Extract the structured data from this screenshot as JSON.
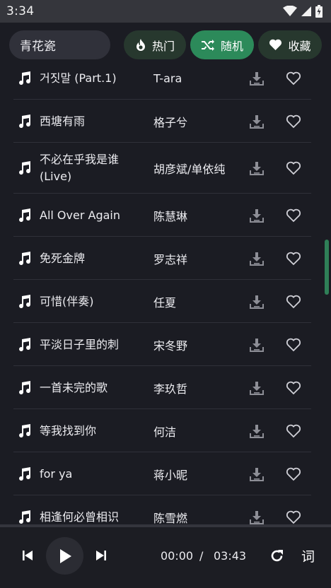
{
  "status": {
    "time": "3:34"
  },
  "search": {
    "value": "青花瓷"
  },
  "tabs": [
    {
      "label": "热门",
      "icon": "fire-icon"
    },
    {
      "label": "随机",
      "icon": "shuffle-icon"
    },
    {
      "label": "收藏",
      "icon": "heart-icon"
    }
  ],
  "songs": [
    {
      "title": "거짓말 (Part.1)",
      "artist": "T-ara"
    },
    {
      "title": "西塘有雨",
      "artist": "格子兮"
    },
    {
      "title": "不必在乎我是谁(Live)",
      "artist": "胡彦斌/单依纯"
    },
    {
      "title": "All Over Again",
      "artist": "陈慧琳"
    },
    {
      "title": "免死金牌",
      "artist": "罗志祥"
    },
    {
      "title": "可惜(伴奏)",
      "artist": "任夏"
    },
    {
      "title": "平淡日子里的刺",
      "artist": "宋冬野"
    },
    {
      "title": "一首未完的歌",
      "artist": "李玖哲"
    },
    {
      "title": "等我找到你",
      "artist": "何洁"
    },
    {
      "title": "for ya",
      "artist": "蒋小昵"
    },
    {
      "title": "相逢何必曾相识",
      "artist": "陈雪燃"
    }
  ],
  "player": {
    "current_time": "00:00",
    "separator": "/",
    "total_time": "03:43",
    "progress": 0,
    "lyrics_label": "词"
  },
  "colors": {
    "accent": "#2c8a5a",
    "background": "#1b1c23"
  }
}
